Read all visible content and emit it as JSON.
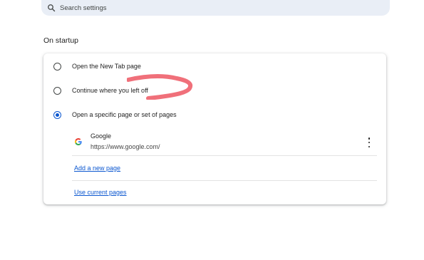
{
  "search": {
    "placeholder": "Search settings"
  },
  "startup": {
    "section_title": "On startup",
    "options": [
      {
        "label": "Open the New Tab page",
        "checked": false
      },
      {
        "label": "Continue where you left off",
        "checked": false
      },
      {
        "label": "Open a specific page or set of pages",
        "checked": true
      }
    ],
    "pages": [
      {
        "title": "Google",
        "url": "https://www.google.com/"
      }
    ],
    "add_page_label": "Add a new page",
    "use_current_label": "Use current pages"
  },
  "colors": {
    "accent": "#0b57d0",
    "search_bg": "#e9eef6",
    "scribble": "#f0707a"
  },
  "icons": {
    "search": "search-icon",
    "favicon": "google-favicon-icon",
    "more": "more-vert-icon"
  }
}
